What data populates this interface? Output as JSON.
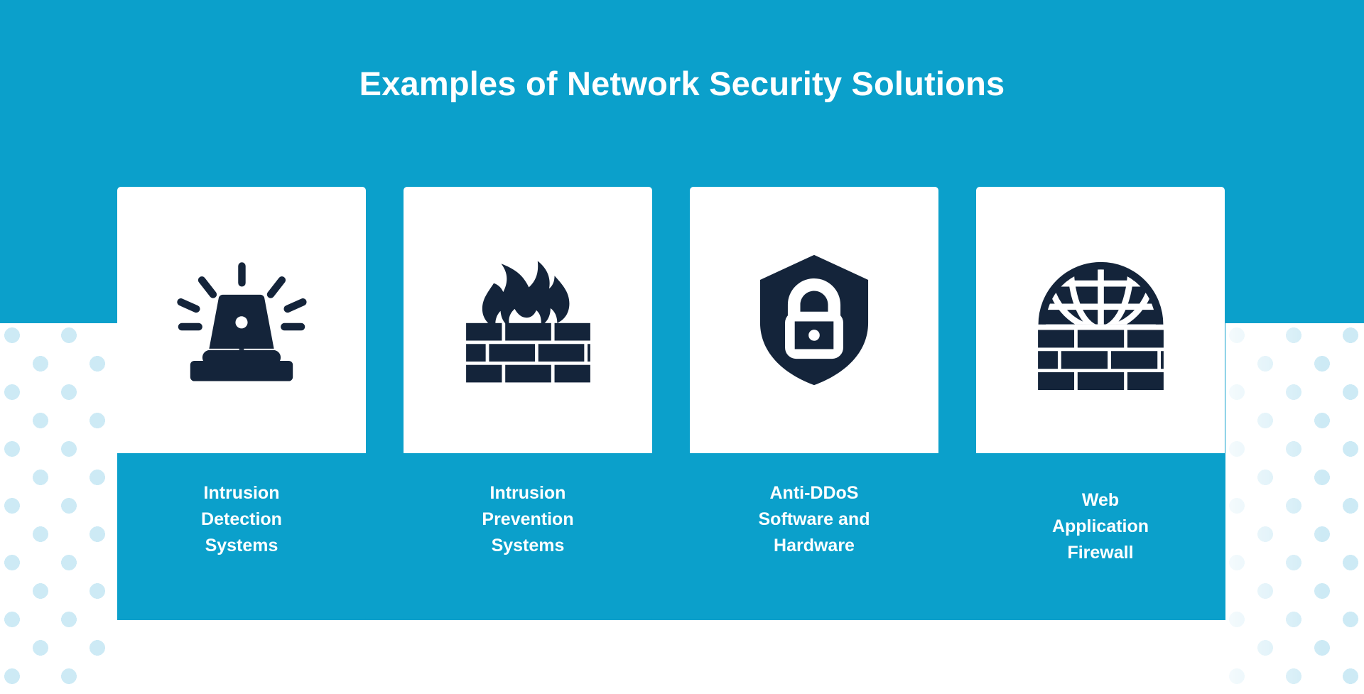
{
  "header": {
    "title": "Examples of Network Security Solutions"
  },
  "theme": {
    "accent_blue": "#0ba0cb",
    "icon_navy": "#14243a",
    "dot_blue": "#cdeaf5",
    "background": "#ffffff",
    "card_surface": "#ffffff"
  },
  "cards": [
    {
      "id": "intrusion-detection-systems",
      "label": "Intrusion\nDetection\nSystems",
      "icon": "alarm-siren-icon"
    },
    {
      "id": "intrusion-prevention-systems",
      "label": "Intrusion\nPrevention\nSystems",
      "icon": "firewall-flame-brick-icon"
    },
    {
      "id": "anti-ddos-software-and-hardware",
      "label": "Anti-DDoS\nSoftware and\nHardware",
      "icon": "shield-lock-icon"
    },
    {
      "id": "web-application-firewall",
      "label": "Web\nApplication\nFirewall",
      "icon": "globe-brick-wall-icon"
    }
  ]
}
